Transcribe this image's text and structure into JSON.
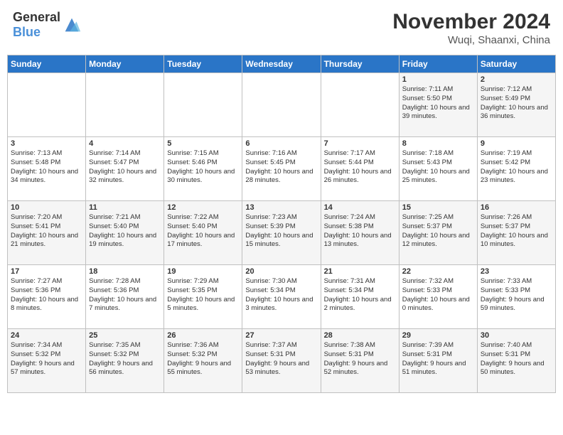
{
  "header": {
    "logo_general": "General",
    "logo_blue": "Blue",
    "month": "November 2024",
    "location": "Wuqi, Shaanxi, China"
  },
  "weekdays": [
    "Sunday",
    "Monday",
    "Tuesday",
    "Wednesday",
    "Thursday",
    "Friday",
    "Saturday"
  ],
  "weeks": [
    [
      {
        "day": "",
        "info": ""
      },
      {
        "day": "",
        "info": ""
      },
      {
        "day": "",
        "info": ""
      },
      {
        "day": "",
        "info": ""
      },
      {
        "day": "",
        "info": ""
      },
      {
        "day": "1",
        "info": "Sunrise: 7:11 AM\nSunset: 5:50 PM\nDaylight: 10 hours and 39 minutes."
      },
      {
        "day": "2",
        "info": "Sunrise: 7:12 AM\nSunset: 5:49 PM\nDaylight: 10 hours and 36 minutes."
      }
    ],
    [
      {
        "day": "3",
        "info": "Sunrise: 7:13 AM\nSunset: 5:48 PM\nDaylight: 10 hours and 34 minutes."
      },
      {
        "day": "4",
        "info": "Sunrise: 7:14 AM\nSunset: 5:47 PM\nDaylight: 10 hours and 32 minutes."
      },
      {
        "day": "5",
        "info": "Sunrise: 7:15 AM\nSunset: 5:46 PM\nDaylight: 10 hours and 30 minutes."
      },
      {
        "day": "6",
        "info": "Sunrise: 7:16 AM\nSunset: 5:45 PM\nDaylight: 10 hours and 28 minutes."
      },
      {
        "day": "7",
        "info": "Sunrise: 7:17 AM\nSunset: 5:44 PM\nDaylight: 10 hours and 26 minutes."
      },
      {
        "day": "8",
        "info": "Sunrise: 7:18 AM\nSunset: 5:43 PM\nDaylight: 10 hours and 25 minutes."
      },
      {
        "day": "9",
        "info": "Sunrise: 7:19 AM\nSunset: 5:42 PM\nDaylight: 10 hours and 23 minutes."
      }
    ],
    [
      {
        "day": "10",
        "info": "Sunrise: 7:20 AM\nSunset: 5:41 PM\nDaylight: 10 hours and 21 minutes."
      },
      {
        "day": "11",
        "info": "Sunrise: 7:21 AM\nSunset: 5:40 PM\nDaylight: 10 hours and 19 minutes."
      },
      {
        "day": "12",
        "info": "Sunrise: 7:22 AM\nSunset: 5:40 PM\nDaylight: 10 hours and 17 minutes."
      },
      {
        "day": "13",
        "info": "Sunrise: 7:23 AM\nSunset: 5:39 PM\nDaylight: 10 hours and 15 minutes."
      },
      {
        "day": "14",
        "info": "Sunrise: 7:24 AM\nSunset: 5:38 PM\nDaylight: 10 hours and 13 minutes."
      },
      {
        "day": "15",
        "info": "Sunrise: 7:25 AM\nSunset: 5:37 PM\nDaylight: 10 hours and 12 minutes."
      },
      {
        "day": "16",
        "info": "Sunrise: 7:26 AM\nSunset: 5:37 PM\nDaylight: 10 hours and 10 minutes."
      }
    ],
    [
      {
        "day": "17",
        "info": "Sunrise: 7:27 AM\nSunset: 5:36 PM\nDaylight: 10 hours and 8 minutes."
      },
      {
        "day": "18",
        "info": "Sunrise: 7:28 AM\nSunset: 5:36 PM\nDaylight: 10 hours and 7 minutes."
      },
      {
        "day": "19",
        "info": "Sunrise: 7:29 AM\nSunset: 5:35 PM\nDaylight: 10 hours and 5 minutes."
      },
      {
        "day": "20",
        "info": "Sunrise: 7:30 AM\nSunset: 5:34 PM\nDaylight: 10 hours and 3 minutes."
      },
      {
        "day": "21",
        "info": "Sunrise: 7:31 AM\nSunset: 5:34 PM\nDaylight: 10 hours and 2 minutes."
      },
      {
        "day": "22",
        "info": "Sunrise: 7:32 AM\nSunset: 5:33 PM\nDaylight: 10 hours and 0 minutes."
      },
      {
        "day": "23",
        "info": "Sunrise: 7:33 AM\nSunset: 5:33 PM\nDaylight: 9 hours and 59 minutes."
      }
    ],
    [
      {
        "day": "24",
        "info": "Sunrise: 7:34 AM\nSunset: 5:32 PM\nDaylight: 9 hours and 57 minutes."
      },
      {
        "day": "25",
        "info": "Sunrise: 7:35 AM\nSunset: 5:32 PM\nDaylight: 9 hours and 56 minutes."
      },
      {
        "day": "26",
        "info": "Sunrise: 7:36 AM\nSunset: 5:32 PM\nDaylight: 9 hours and 55 minutes."
      },
      {
        "day": "27",
        "info": "Sunrise: 7:37 AM\nSunset: 5:31 PM\nDaylight: 9 hours and 53 minutes."
      },
      {
        "day": "28",
        "info": "Sunrise: 7:38 AM\nSunset: 5:31 PM\nDaylight: 9 hours and 52 minutes."
      },
      {
        "day": "29",
        "info": "Sunrise: 7:39 AM\nSunset: 5:31 PM\nDaylight: 9 hours and 51 minutes."
      },
      {
        "day": "30",
        "info": "Sunrise: 7:40 AM\nSunset: 5:31 PM\nDaylight: 9 hours and 50 minutes."
      }
    ]
  ]
}
